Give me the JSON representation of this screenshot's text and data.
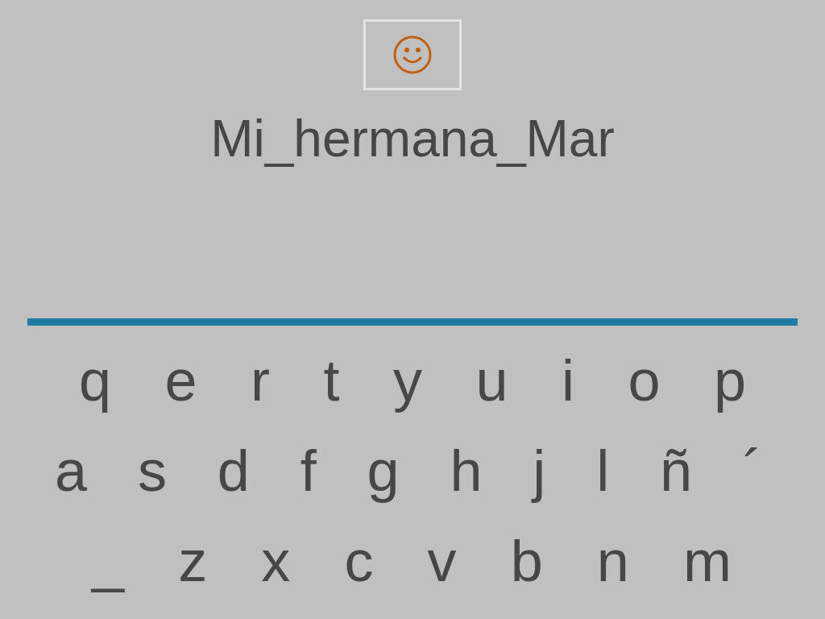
{
  "title": "Mi_hermana_Mar",
  "keyboard": [
    [
      "q",
      "e",
      "r",
      "t",
      "y",
      "u",
      "i",
      "o",
      "p"
    ],
    [
      "a",
      "s",
      "d",
      "f",
      "g",
      "h",
      "j",
      "l",
      "ñ",
      "´"
    ],
    [
      "_",
      "z",
      "x",
      "c",
      "v",
      "b",
      "n",
      "m"
    ]
  ]
}
